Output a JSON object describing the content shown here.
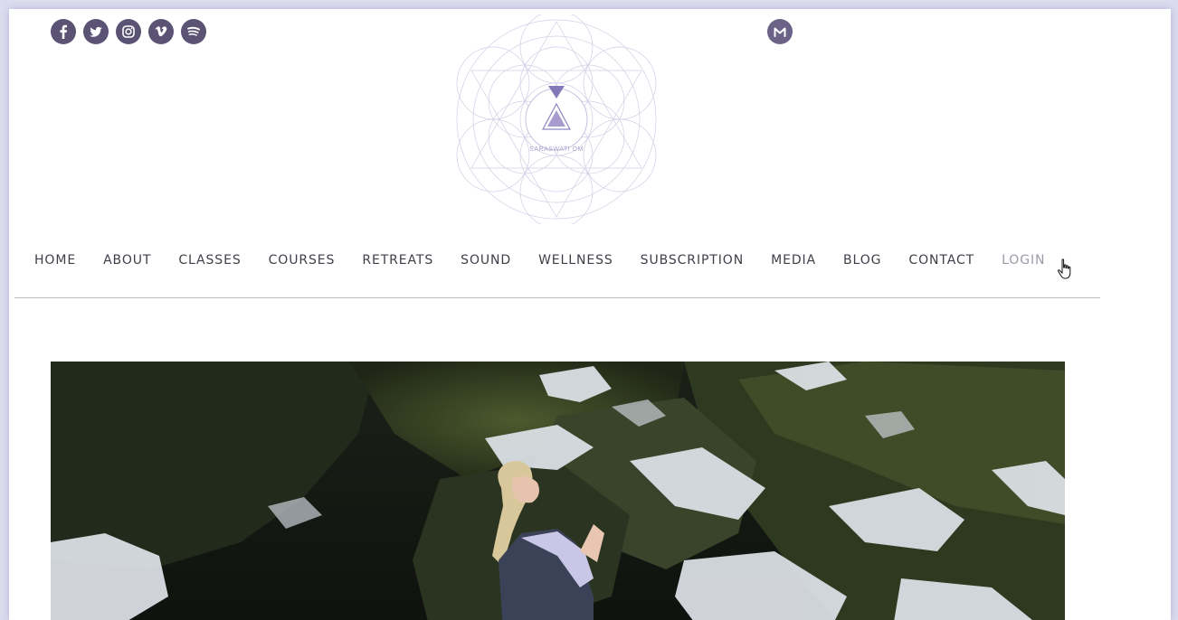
{
  "social": {
    "icons": [
      "facebook-icon",
      "twitter-icon",
      "instagram-icon",
      "vimeo-icon",
      "spotify-icon"
    ],
    "color": "#5b5374",
    "mail_icon": "mail-icon",
    "mail_color": "#6b6288"
  },
  "logo": {
    "text": "SARASWATI OM",
    "accent": "#8479b8"
  },
  "nav": {
    "items": [
      "HOME",
      "ABOUT",
      "CLASSES",
      "COURSES",
      "RETREATS",
      "SOUND",
      "WELLNESS",
      "SUBSCRIPTION",
      "MEDIA",
      "BLOG",
      "CONTACT",
      "LOGIN"
    ],
    "active": "LOGIN",
    "color": "#3f3f4a",
    "active_color": "#9b9ba8"
  },
  "hero": {
    "image": "woman-praying-in-snowy-mossy-canyon"
  }
}
